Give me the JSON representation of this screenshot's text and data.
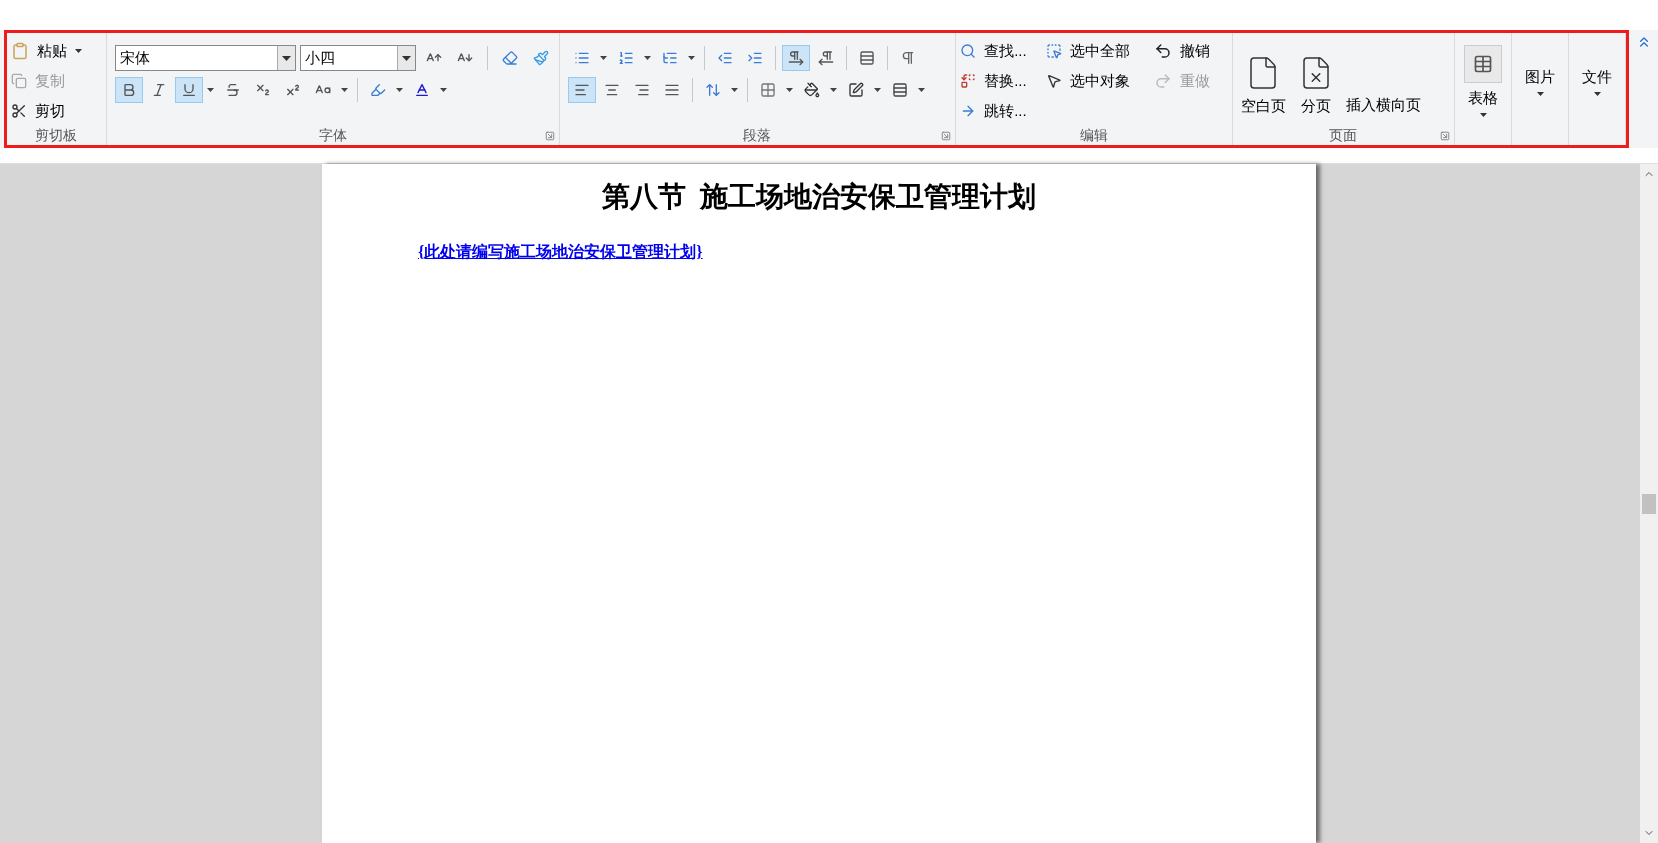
{
  "clipboard": {
    "label": "剪切板",
    "paste": "粘贴",
    "copy": {
      "label": "复制",
      "disabled": true
    },
    "cut": "剪切"
  },
  "font": {
    "label": "字体",
    "font_name": "宋体",
    "font_size": "小四",
    "toggles": [
      {
        "kind": "bold",
        "selected": true
      },
      {
        "kind": "italic",
        "selected": false
      },
      {
        "kind": "underline",
        "selected": true
      },
      {
        "kind": "strike",
        "selected": false
      },
      {
        "kind": "subscript",
        "selected": false
      },
      {
        "kind": "superscript",
        "selected": false
      }
    ]
  },
  "paragraph": {
    "label": "段落",
    "direction": [
      {
        "kind": "ltr",
        "selected": true
      },
      {
        "kind": "rtl",
        "selected": false
      }
    ],
    "show_marks": {
      "selected": false
    },
    "align": [
      {
        "kind": "left",
        "selected": true
      },
      {
        "kind": "center",
        "selected": false
      },
      {
        "kind": "right",
        "selected": false
      },
      {
        "kind": "justify",
        "selected": false
      }
    ]
  },
  "editing": {
    "label": "编辑",
    "find": "查找...",
    "replace": "替换...",
    "goto": "跳转...",
    "select_all": "选中全部",
    "select_objects": "选中对象",
    "undo": {
      "label": "撤销",
      "disabled": false
    },
    "redo": {
      "label": "重做",
      "disabled": true
    }
  },
  "page": {
    "label": "页面",
    "blank_page": "空白页",
    "page_break": "分页",
    "landscape_page": "插入横向页"
  },
  "insert_buttons": [
    {
      "kind": "table",
      "label": "表格"
    },
    {
      "kind": "picture",
      "label": "图片"
    },
    {
      "kind": "file",
      "label": "文件"
    }
  ],
  "document": {
    "title": "第八节  施工场地治安保卫管理计划",
    "placeholder_link": "{此处请编写施工场地治安保卫管理计划}"
  }
}
